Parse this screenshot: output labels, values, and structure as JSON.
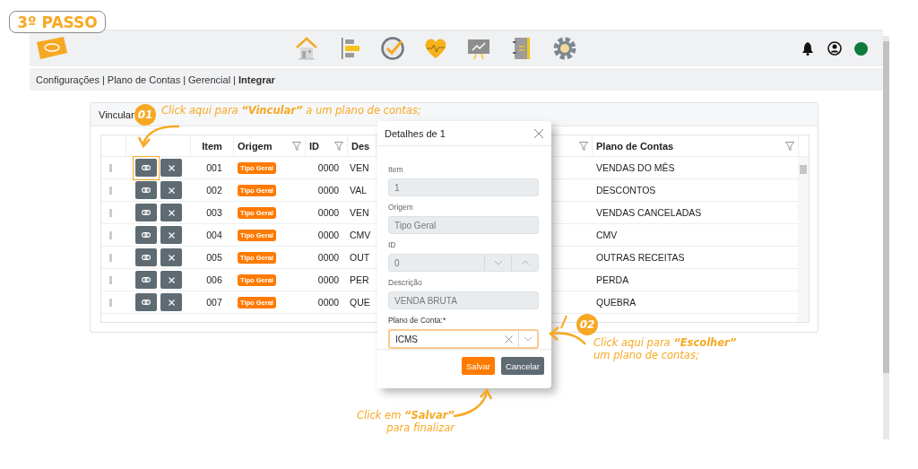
{
  "step_badge": "3º PASSO",
  "breadcrumb": {
    "separator": "|",
    "items": [
      {
        "label": "Configurações",
        "current": false
      },
      {
        "label": "Plano de Contas",
        "current": false
      },
      {
        "label": "Gerencial",
        "current": false
      },
      {
        "label": "Integrar",
        "current": true
      }
    ]
  },
  "panel": {
    "title": "Vincular",
    "table": {
      "columns": [
        {
          "label": "Item",
          "filter": false
        },
        {
          "label": "Origem",
          "filter": true
        },
        {
          "label": "ID",
          "filter": true
        },
        {
          "label": "Des",
          "filter": false
        },
        {
          "filter": true
        },
        {
          "label": "Plano de Contas",
          "filter": true
        }
      ],
      "rows": [
        {
          "item": "001",
          "origem": "Tipo Geral",
          "id": "0000",
          "descricao": "VEN",
          "plano_de_contas": "VENDAS DO MÊS",
          "highlighted": true
        },
        {
          "item": "002",
          "origem": "Tipo Geral",
          "id": "0000",
          "descricao": "VAL",
          "plano_de_contas": "DESCONTOS",
          "highlighted": false
        },
        {
          "item": "003",
          "origem": "Tipo Geral",
          "id": "0000",
          "descricao": "VEN",
          "plano_de_contas": "VENDAS CANCELADAS",
          "highlighted": false
        },
        {
          "item": "004",
          "origem": "Tipo Geral",
          "id": "0000",
          "descricao": "CMV",
          "plano_de_contas": "CMV",
          "highlighted": false
        },
        {
          "item": "005",
          "origem": "Tipo Geral",
          "id": "0000",
          "descricao": "OUT",
          "plano_de_contas": "OUTRAS RECEITAS",
          "highlighted": false
        },
        {
          "item": "006",
          "origem": "Tipo Geral",
          "id": "0000",
          "descricao": "PER",
          "plano_de_contas": "PERDA",
          "highlighted": false
        },
        {
          "item": "007",
          "origem": "Tipo Geral",
          "id": "0000",
          "descricao": "QUE",
          "plano_de_contas": "QUEBRA",
          "highlighted": false
        }
      ]
    }
  },
  "modal": {
    "title": "Detalhes de 1",
    "fields": [
      {
        "kind": "text",
        "label": "Item",
        "value": "1"
      },
      {
        "kind": "text",
        "label": "Origem",
        "value": "Tipo Geral"
      },
      {
        "kind": "spinner",
        "label": "ID",
        "value": "0"
      },
      {
        "kind": "text",
        "label": "Descrição",
        "value": "VENDA BRUTA"
      },
      {
        "kind": "select",
        "label": "Plano de Conta:*",
        "value": "ICMS"
      }
    ],
    "buttons": [
      {
        "label": "Salvar",
        "kind": "primary"
      },
      {
        "label": "Cancelar",
        "kind": "secondary"
      }
    ]
  },
  "annotations": [
    {
      "number": "01",
      "lines": [
        "Click aqui para **“Vincular”** a um plano de contas;"
      ]
    },
    {
      "number": "02",
      "lines": [
        "Click aqui para **“Escolher”**",
        "um plano de contas;"
      ]
    },
    {
      "lines": [
        "Click em **“Salvar”**",
        "para finalizar"
      ]
    }
  ]
}
